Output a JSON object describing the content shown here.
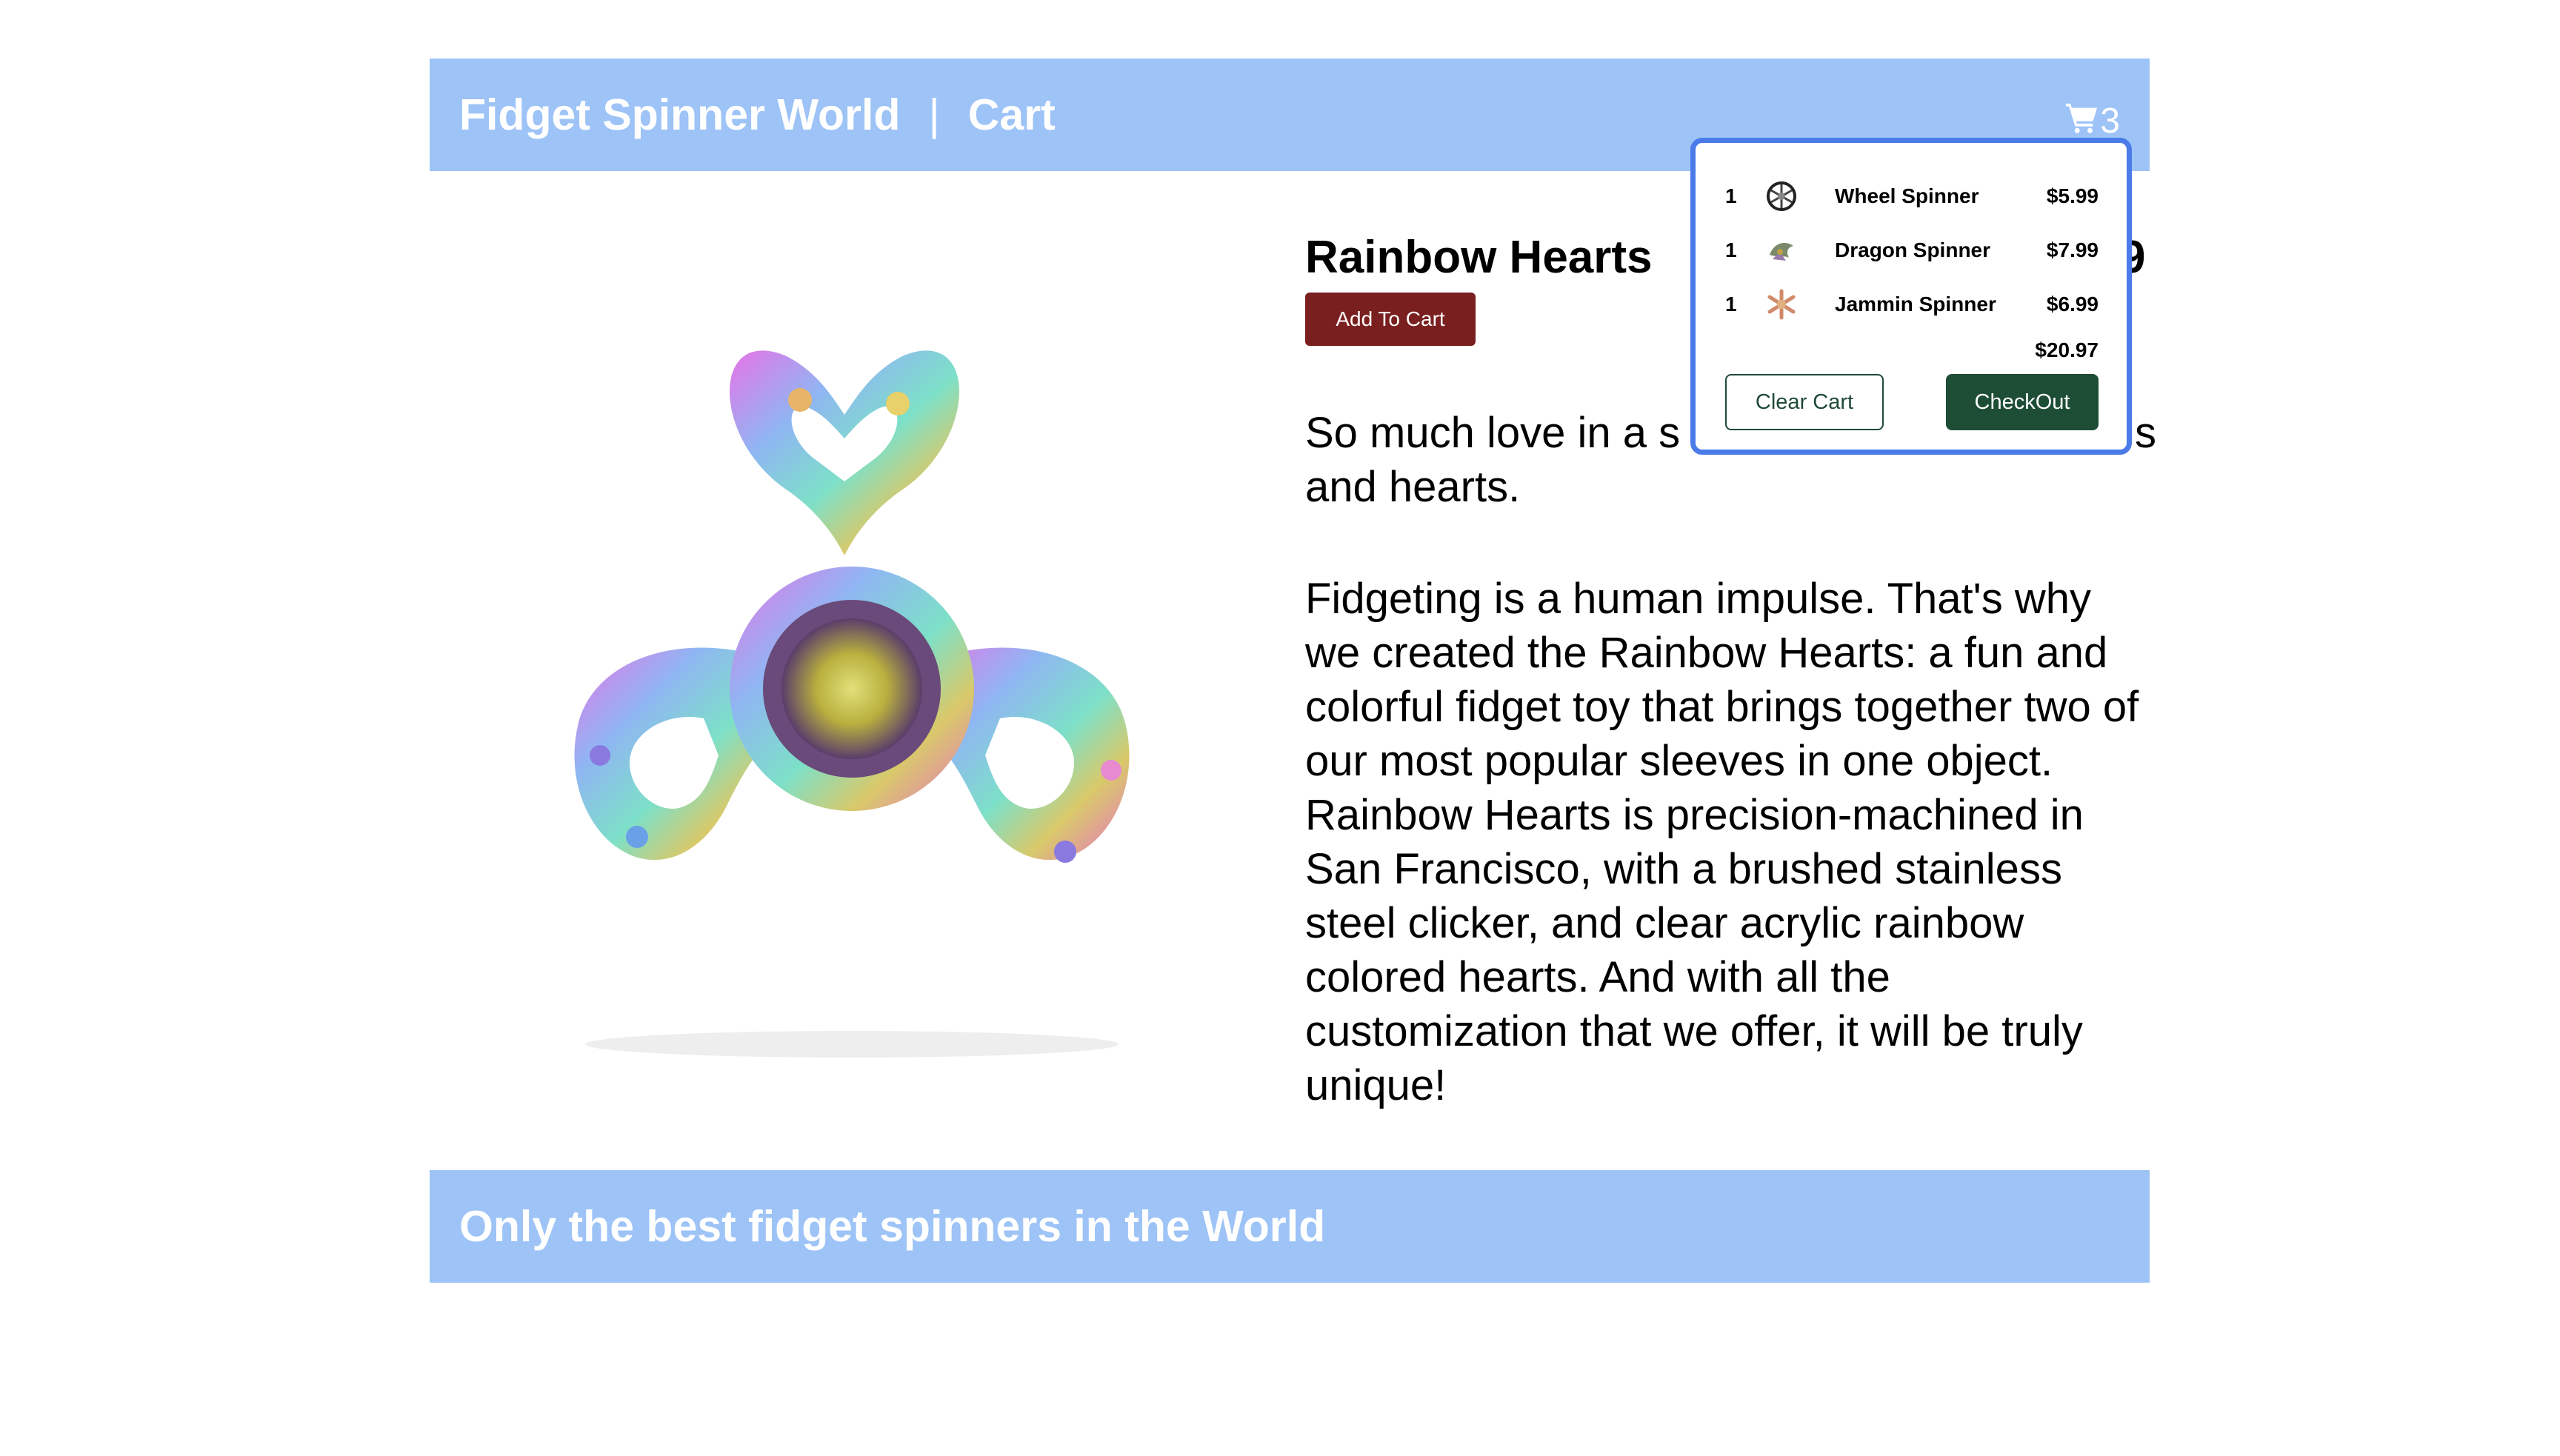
{
  "header": {
    "site_name": "Fidget Spinner World",
    "separator": "|",
    "cart_link": "Cart",
    "cart_icon": "shopping-cart-icon",
    "cart_count": "3"
  },
  "product": {
    "title": "Rainbow Hearts",
    "price_visible_fragment": "9",
    "add_to_cart_label": "Add To Cart",
    "description_1_part1": "So much love in a s",
    "description_1_part1_hidden_end": "s",
    "description_1_part2": "and hearts.",
    "description_2": "Fidgeting is a human impulse. That's why we created the Rainbow Hearts: a fun and colorful fidget toy that brings together two of our most popular sleeves in one object. Rainbow Hearts is precision-machined in San Francisco, with a brushed stainless steel clicker, and clear acrylic rainbow colored hearts. And with all the customization that we offer, it will be truly unique!",
    "image_icon": "rainbow-hearts-spinner-image"
  },
  "cart_popup": {
    "items": [
      {
        "qty": "1",
        "name": "Wheel Spinner",
        "price": "$5.99",
        "icon": "wheel-spinner-thumb"
      },
      {
        "qty": "1",
        "name": "Dragon Spinner",
        "price": "$7.99",
        "icon": "dragon-spinner-thumb"
      },
      {
        "qty": "1",
        "name": "Jammin Spinner",
        "price": "$6.99",
        "icon": "jammin-spinner-thumb"
      }
    ],
    "total": "$20.97",
    "clear_label": "Clear Cart",
    "checkout_label": "CheckOut"
  },
  "footer": {
    "tagline": "Only the best fidget spinners in the World"
  },
  "colors": {
    "header_bg": "#9dc3f7",
    "add_to_cart_bg": "#7a1f1f",
    "checkout_bg": "#1e4d36",
    "popup_border": "#4a7be8"
  }
}
